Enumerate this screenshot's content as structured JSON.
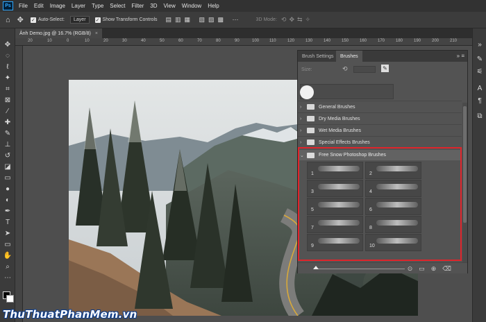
{
  "app": {
    "logo": "Ps",
    "menu": [
      "File",
      "Edit",
      "Image",
      "Layer",
      "Type",
      "Select",
      "Filter",
      "3D",
      "View",
      "Window",
      "Help"
    ]
  },
  "options_bar": {
    "auto_select_label": "Auto-Select:",
    "auto_select_value": "Layer",
    "show_transform_label": "Show Transform Controls",
    "mode_3d_label": "3D Mode:"
  },
  "document": {
    "tab_title": "Ảnh Demo.jpg @ 16.7% (RGB/8)",
    "close_glyph": "×"
  },
  "ruler": {
    "ticks": [
      "20",
      "10",
      "0",
      "10",
      "20",
      "30",
      "40",
      "50",
      "60",
      "70",
      "80",
      "90",
      "100",
      "110",
      "120",
      "130",
      "140",
      "150",
      "160",
      "170",
      "180",
      "190",
      "200",
      "210"
    ]
  },
  "panel": {
    "tabs": [
      "Brush Settings",
      "Brushes"
    ],
    "active_tab": "Brushes",
    "menu_glyph": "»  ≡",
    "size_label": "Size:",
    "folders": [
      "General Brushes",
      "Dry Media Brushes",
      "Wet Media Brushes",
      "Special Effects Brushes"
    ],
    "open_folder": "Free Snow Photoshop Brushes",
    "brushes": [
      "1",
      "2",
      "3",
      "4",
      "5",
      "6",
      "7",
      "8",
      "9",
      "10"
    ]
  },
  "watermark": {
    "text": "ThuThuatPhanMem.vn"
  },
  "colors": {
    "highlight": "#e0242b",
    "ps_blue": "#31a8ff"
  }
}
